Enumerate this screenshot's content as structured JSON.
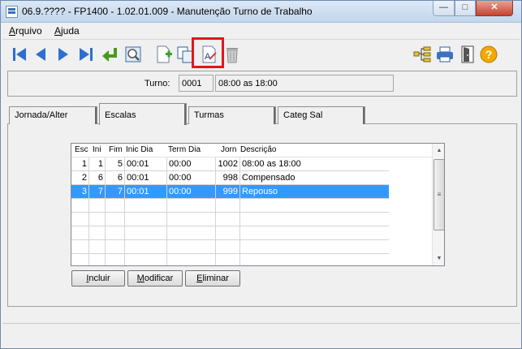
{
  "window": {
    "title": "06.9.???? - FP1400 - 1.02.01.009 - Manutenção Turno de Trabalho",
    "controls": {
      "minimize": "—",
      "maximize": "□",
      "close": "✕"
    }
  },
  "menu": {
    "items": [
      {
        "accesskey": "A",
        "rest": "rquivo"
      },
      {
        "accesskey": "A",
        "rest": "juda"
      }
    ]
  },
  "toolbar": {
    "icons": [
      "first-record-icon",
      "previous-record-icon",
      "next-record-icon",
      "last-record-icon",
      "return-icon",
      "zoom-icon",
      "new-record-icon",
      "copy-record-icon",
      "edit-record-icon",
      "delete-record-icon",
      "tree-structure-icon",
      "print-icon",
      "exit-icon",
      "help-icon"
    ],
    "highlight_color": "#e0161d"
  },
  "turno": {
    "label": "Turno:",
    "code": "0001",
    "description": "08:00 as 18:00"
  },
  "tabs": [
    {
      "label": "Jornada/Alter"
    },
    {
      "label": "Escalas",
      "active": true
    },
    {
      "label": "Turmas"
    },
    {
      "label": "Categ Sal"
    }
  ],
  "grid": {
    "columns": [
      "Esc",
      "Ini",
      "Fim",
      "Inic Dia",
      "Term Dia",
      "Jorn",
      "Descrição"
    ],
    "rows": [
      {
        "esc": "1",
        "ini": "1",
        "fim": "5",
        "inic": "00:01",
        "term": "00:00",
        "jorn": "1002",
        "desc": "08:00 as 18:00",
        "selected": false
      },
      {
        "esc": "2",
        "ini": "6",
        "fim": "6",
        "inic": "00:01",
        "term": "00:00",
        "jorn": "998",
        "desc": "Compensado",
        "selected": false
      },
      {
        "esc": "3",
        "ini": "7",
        "fim": "7",
        "inic": "00:01",
        "term": "00:00",
        "jorn": "999",
        "desc": "Repouso",
        "selected": true
      }
    ],
    "selection_color": "#3399ff"
  },
  "buttons": {
    "incluir": {
      "accesskey": "I",
      "rest": "ncluir"
    },
    "modificar": {
      "accesskey": "M",
      "rest": "odificar"
    },
    "eliminar": {
      "accesskey": "E",
      "rest": "liminar"
    }
  }
}
